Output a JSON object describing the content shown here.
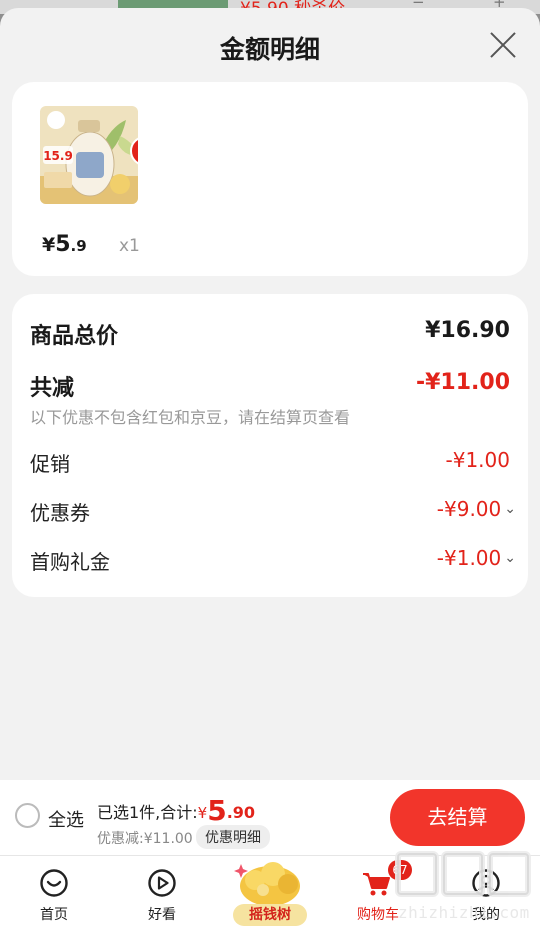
{
  "background": {
    "price_peek": "¥5.90 秒杀价",
    "minus": "−",
    "plus": "+"
  },
  "sheet": {
    "title": "金额明细",
    "close_icon": "close-icon"
  },
  "product": {
    "image_icon": "laundry-detergent-product-image",
    "image_text": "15.9",
    "price_symbol": "¥",
    "price_int": "5",
    "price_dec": ".9",
    "quantity": "x1"
  },
  "summary": {
    "total_label": "商品总价",
    "total_value": "¥16.90",
    "reduce_label": "共减",
    "reduce_value": "-¥11.00",
    "note": "以下优惠不包含红包和京豆，请在结算页查看",
    "promo_label": "促销",
    "promo_value": "-¥1.00",
    "coupon_label": "优惠券",
    "coupon_value": "-¥9.00",
    "gift_label": "首购礼金",
    "gift_value": "-¥1.00",
    "chevron": "chevron-down-icon"
  },
  "checkout": {
    "select_all": "全选",
    "selected_text": "已选1件,合计:",
    "total_symbol": "¥",
    "total_int": "5",
    "total_dec": ".90",
    "discount_text": "优惠减:¥11.00",
    "detail_tag": "优惠明细",
    "pay_button": "去结算"
  },
  "tabbar": {
    "items": [
      {
        "label": "首页",
        "icon": "home-icon"
      },
      {
        "label": "好看",
        "icon": "video-play-icon"
      },
      {
        "label": "摇钱树",
        "icon": "money-tree-icon"
      },
      {
        "label": "购物车",
        "icon": "cart-icon",
        "badge": "67"
      },
      {
        "label": "我的",
        "icon": "profile-icon"
      }
    ],
    "active_color": "#e2231a"
  },
  "watermark": {
    "text": "zhizhizhi.com"
  },
  "colors": {
    "accent": "#e2231a",
    "pay_button": "#f2352b",
    "sheet_bg": "#f2f2f2",
    "card_bg": "#ffffff"
  }
}
